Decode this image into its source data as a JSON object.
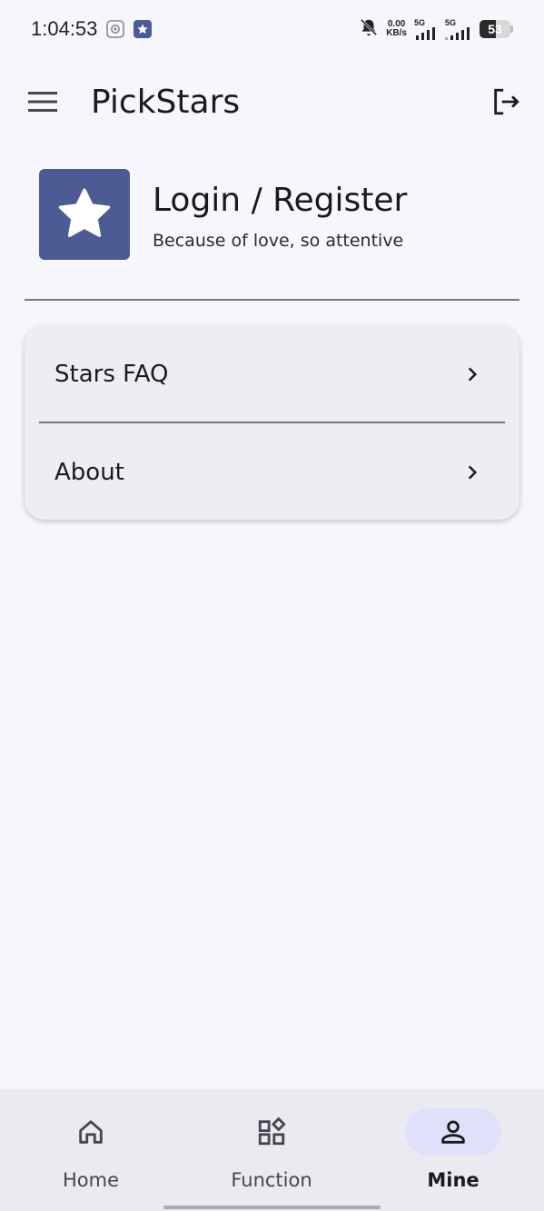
{
  "status_bar": {
    "time": "1:04:53",
    "net_speed_value": "0.00",
    "net_speed_unit": "KB/s",
    "signal1_label": "5G",
    "signal2_label": "5G",
    "battery_level": "53",
    "battery_fraction": 0.53,
    "icons": [
      "settings-icon",
      "star-app-icon",
      "bell-off-icon",
      "signal-icon",
      "battery-icon"
    ]
  },
  "app_bar": {
    "title": "PickStars",
    "icons": [
      "menu-icon",
      "logout-icon"
    ]
  },
  "profile": {
    "name": "Login / Register",
    "subtitle": "Because of love, so attentive",
    "avatar_icon": "star-icon",
    "avatar_color": "#4d5b94"
  },
  "menu_card": {
    "items": [
      {
        "label": "Stars FAQ",
        "icon": "chevron-right-icon"
      },
      {
        "label": "About",
        "icon": "chevron-right-icon"
      }
    ]
  },
  "bottom_nav": {
    "items": [
      {
        "label": "Home",
        "icon": "home-icon",
        "active": false
      },
      {
        "label": "Function",
        "icon": "function-grid-icon",
        "active": false
      },
      {
        "label": "Mine",
        "icon": "person-icon",
        "active": true
      }
    ],
    "active_indicator_color": "#dfe0f9"
  },
  "colors": {
    "background": "#f7f6fc",
    "card": "#eeedf3",
    "nav_bar": "#eceaf1",
    "accent": "#4d5b94"
  }
}
